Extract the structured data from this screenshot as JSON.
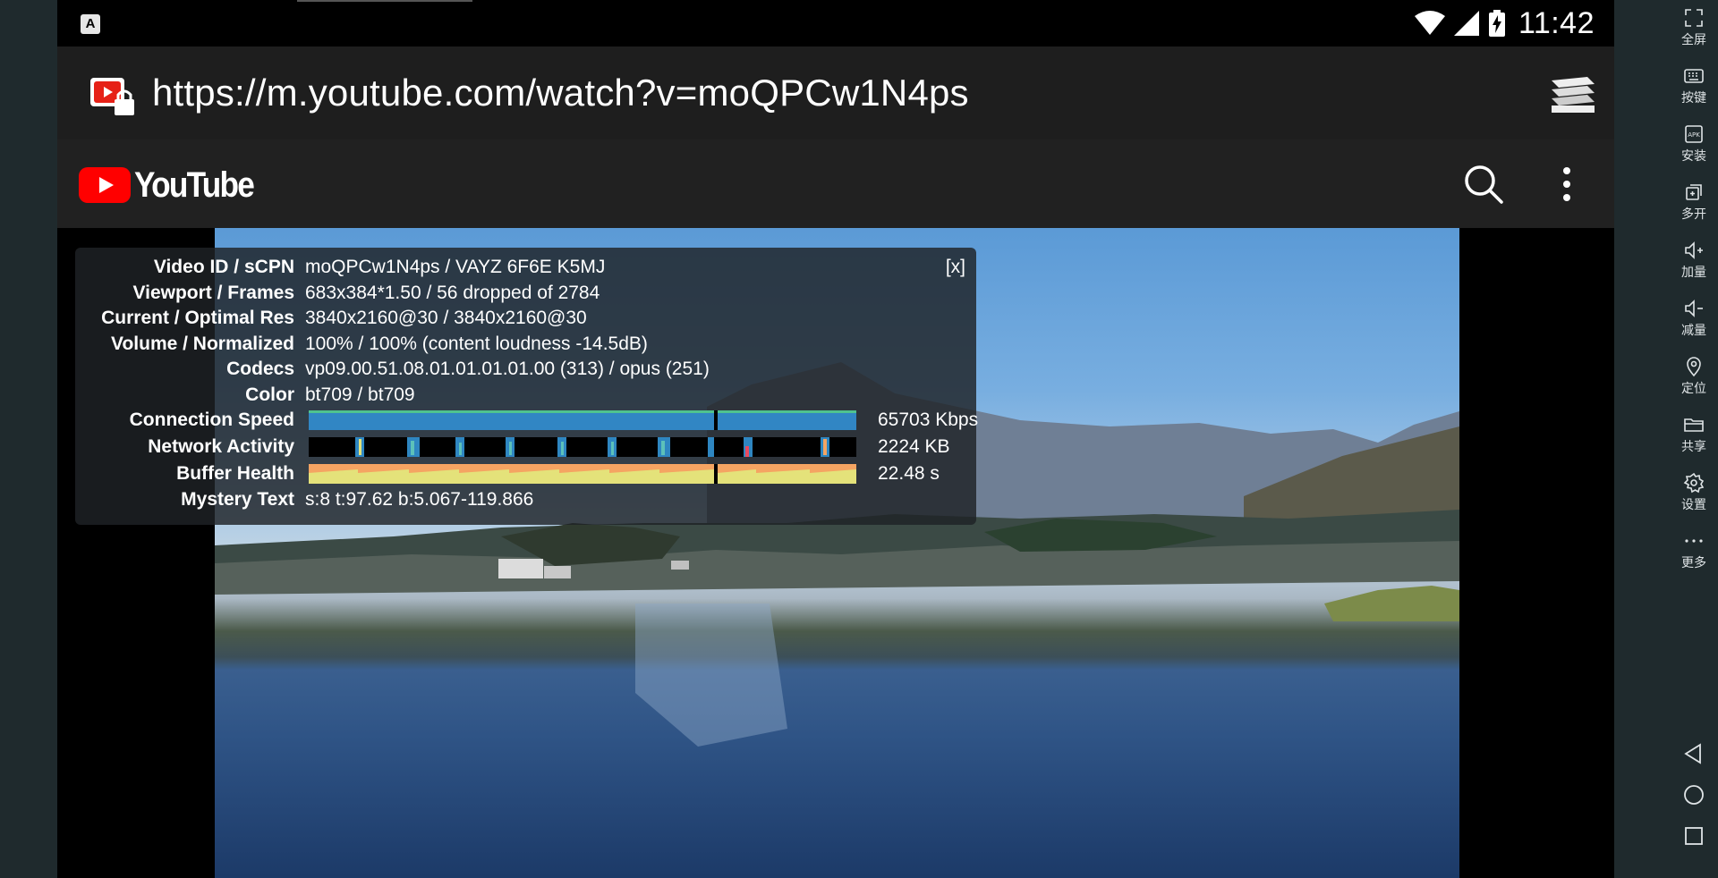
{
  "status_bar": {
    "time": "11:42",
    "notification_icon_letter": "A"
  },
  "browser": {
    "url": "https://m.youtube.com/watch?v=moQPCw1N4ps"
  },
  "youtube": {
    "logo_text": "YouTube"
  },
  "stats_for_nerds": {
    "close_label": "[x]",
    "rows": [
      {
        "label": "Video ID / sCPN",
        "value": "moQPCw1N4ps / VAYZ 6F6E K5MJ"
      },
      {
        "label": "Viewport / Frames",
        "value": "683x384*1.50 / 56 dropped of 2784"
      },
      {
        "label": "Current / Optimal Res",
        "value": "3840x2160@30 / 3840x2160@30"
      },
      {
        "label": "Volume / Normalized",
        "value": "100% / 100% (content loudness -14.5dB)"
      },
      {
        "label": "Codecs",
        "value": "vp09.00.51.08.01.01.01.01.00 (313) / opus (251)"
      },
      {
        "label": "Color",
        "value": "bt709 / bt709"
      }
    ],
    "connection_speed": {
      "label": "Connection Speed",
      "value": "65703 Kbps"
    },
    "network_activity": {
      "label": "Network Activity",
      "value": "2224 KB"
    },
    "buffer_health": {
      "label": "Buffer Health",
      "value": "22.48 s"
    },
    "mystery_text": {
      "label": "Mystery Text",
      "value": "s:8 t:97.62 b:5.067-119.866"
    }
  },
  "side_toolbar": {
    "items": [
      {
        "label": "全屏",
        "icon": "fullscreen-icon"
      },
      {
        "label": "按键",
        "icon": "keyboard-icon"
      },
      {
        "label": "安装",
        "icon": "apk-install-icon"
      },
      {
        "label": "多开",
        "icon": "multi-instance-icon"
      },
      {
        "label": "加量",
        "icon": "volume-up-icon"
      },
      {
        "label": "减量",
        "icon": "volume-down-icon"
      },
      {
        "label": "定位",
        "icon": "location-icon"
      },
      {
        "label": "共享",
        "icon": "folder-icon"
      },
      {
        "label": "设置",
        "icon": "gear-icon"
      },
      {
        "label": "更多",
        "icon": "more-icon"
      }
    ],
    "nav": [
      "back-icon",
      "home-icon",
      "recents-icon"
    ]
  },
  "colors": {
    "youtube_red": "#ff0000",
    "overlay_bg": "#1e2226",
    "graph_blue": "#3186c4",
    "graph_orange": "#f5a462",
    "graph_yellow": "#e4e27a"
  }
}
